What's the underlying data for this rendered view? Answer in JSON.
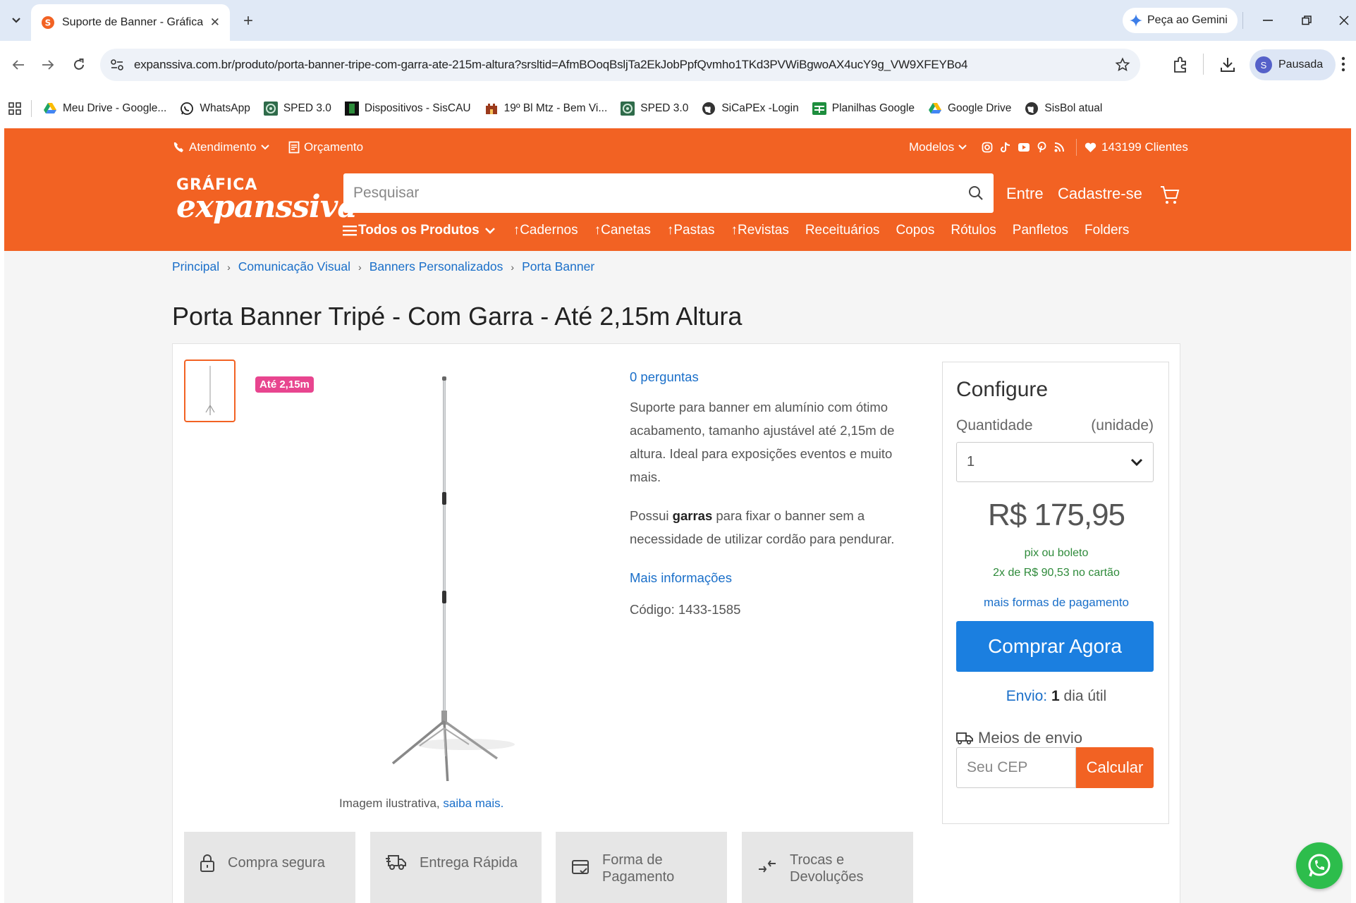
{
  "browser": {
    "tab_title": "Suporte de Banner - Gráfica exp",
    "gemini_label": "Peça ao Gemini",
    "url": "expanssiva.com.br/produto/porta-banner-tripe-com-garra-ate-215m-altura?srsltid=AfmBOoqBsljTa2EkJobPpfQvmho1TKd3PVWiBgwoAX4ucY9g_VW9XFEYBo4",
    "profile_initial": "S",
    "profile_label": "Pausada",
    "bookmarks": [
      {
        "label": "Meu Drive - Google...",
        "icon": "google-drive-icon"
      },
      {
        "label": "WhatsApp",
        "icon": "whatsapp-icon"
      },
      {
        "label": "SPED 3.0",
        "icon": "sped-icon"
      },
      {
        "label": "Dispositivos - SisCAU",
        "icon": "siscau-icon"
      },
      {
        "label": "19º Bl Mtz - Bem Vi...",
        "icon": "castle-icon"
      },
      {
        "label": "SPED 3.0",
        "icon": "sped-icon"
      },
      {
        "label": "SiCaPEx -Login",
        "icon": "globe-icon"
      },
      {
        "label": "Planilhas Google",
        "icon": "sheets-icon"
      },
      {
        "label": "Google Drive",
        "icon": "google-drive-icon"
      },
      {
        "label": "SisBol atual",
        "icon": "globe-icon"
      }
    ]
  },
  "header": {
    "atendimento": "Atendimento",
    "orcamento": "Orçamento",
    "modelos": "Modelos",
    "clients": "143199 Clientes",
    "logo_top": "GRÁFICA",
    "logo_bottom": "expanssiva",
    "search_placeholder": "Pesquisar",
    "login": "Entre",
    "signup": "Cadastre-se",
    "all_products": "Todos os Produtos",
    "categories": [
      "↑Cadernos",
      "↑Canetas",
      "↑Pastas",
      "↑Revistas",
      "Receituários",
      "Copos",
      "Rótulos",
      "Panfletos",
      "Folders"
    ]
  },
  "breadcrumb": [
    "Principal",
    "Comunicação Visual",
    "Banners Personalizados",
    "Porta Banner"
  ],
  "product": {
    "title": "Porta Banner Tripé - Com Garra - Até 2,15m Altura",
    "badge": "Até 2,15m",
    "caption": "Imagem ilustrativa,",
    "caption_link": "saiba mais.",
    "questions": "0 perguntas",
    "description": "Suporte para banner em alumínio com ótimo acabamento, tamanho ajustável até 2,15m de altura. Ideal para exposições eventos e muito mais.",
    "desc2_prefix": "Possui",
    "desc2_bold": "garras",
    "desc2_rest": "para fixar o banner sem a necessidade de utilizar cordão para pendurar.",
    "more_info": "Mais informações",
    "code": "Código: 1433-1585"
  },
  "buybox": {
    "title": "Configure",
    "qty_label": "Quantidade",
    "qty_unit": "(unidade)",
    "qty_value": "1",
    "price": "R$ 175,95",
    "pix": "pix ou boleto",
    "installments": "2x de R$ 90,53 no cartão",
    "payment_link": "mais formas de pagamento",
    "buy_button": "Comprar Agora",
    "ship_prefix": "Envio:",
    "ship_days": "1",
    "ship_suffix": "dia útil",
    "ship_methods": "Meios de envio",
    "cep_placeholder": "Seu CEP",
    "calc_button": "Calcular"
  },
  "features": [
    {
      "label": "Compra segura",
      "icon": "lock-icon"
    },
    {
      "label": "Entrega Rápida",
      "icon": "truck-icon"
    },
    {
      "label": "Forma de Pagamento",
      "icon": "payment-icon"
    },
    {
      "label": "Trocas e Devoluções",
      "icon": "exchange-icon"
    }
  ],
  "colors": {
    "brand": "#f26223",
    "link": "#1a6fc9",
    "buy": "#1b7fe0",
    "badge": "#e8458f",
    "whatsapp": "#2dbd4c"
  }
}
